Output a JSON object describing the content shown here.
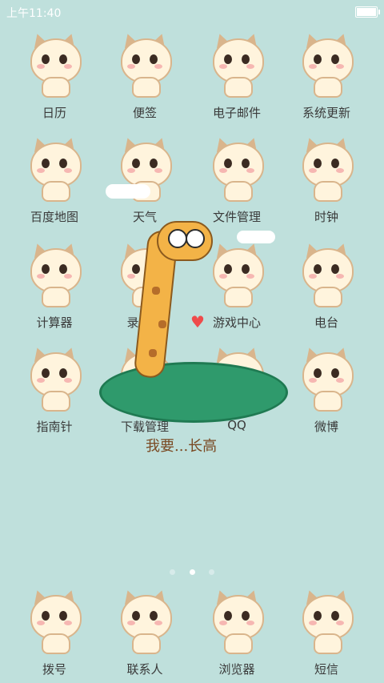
{
  "status_bar": {
    "time": "上午11:40"
  },
  "home_apps": [
    {
      "label": "日历",
      "icon": "calendar-cat-icon"
    },
    {
      "label": "便签",
      "icon": "notes-cat-icon"
    },
    {
      "label": "电子邮件",
      "icon": "email-cat-icon"
    },
    {
      "label": "系统更新",
      "icon": "system-update-cat-icon"
    },
    {
      "label": "百度地图",
      "icon": "baidu-map-cat-icon"
    },
    {
      "label": "天气",
      "icon": "weather-cat-icon"
    },
    {
      "label": "文件管理",
      "icon": "file-manager-cat-icon"
    },
    {
      "label": "时钟",
      "icon": "clock-cat-icon"
    },
    {
      "label": "计算器",
      "icon": "calculator-cat-icon"
    },
    {
      "label": "录音机",
      "icon": "recorder-cat-icon"
    },
    {
      "label": "游戏中心",
      "icon": "game-center-cat-icon"
    },
    {
      "label": "电台",
      "icon": "radio-cat-icon"
    },
    {
      "label": "指南针",
      "icon": "compass-cat-icon"
    },
    {
      "label": "下载管理",
      "icon": "download-manager-cat-icon"
    },
    {
      "label": "QQ",
      "icon": "qq-cat-icon"
    },
    {
      "label": "微博",
      "icon": "weibo-cat-icon"
    }
  ],
  "wallpaper_text": {
    "slogan": "我要...长高"
  },
  "page_indicator": {
    "total": 3,
    "active_index": 1
  },
  "dock_apps": [
    {
      "label": "拨号",
      "icon": "dialer-cat-icon"
    },
    {
      "label": "联系人",
      "icon": "contacts-cat-icon"
    },
    {
      "label": "浏览器",
      "icon": "browser-cat-icon"
    },
    {
      "label": "短信",
      "icon": "messages-cat-icon"
    }
  ],
  "colors": {
    "background": "#bfe0dc",
    "label_text": "#3a3a3a"
  }
}
